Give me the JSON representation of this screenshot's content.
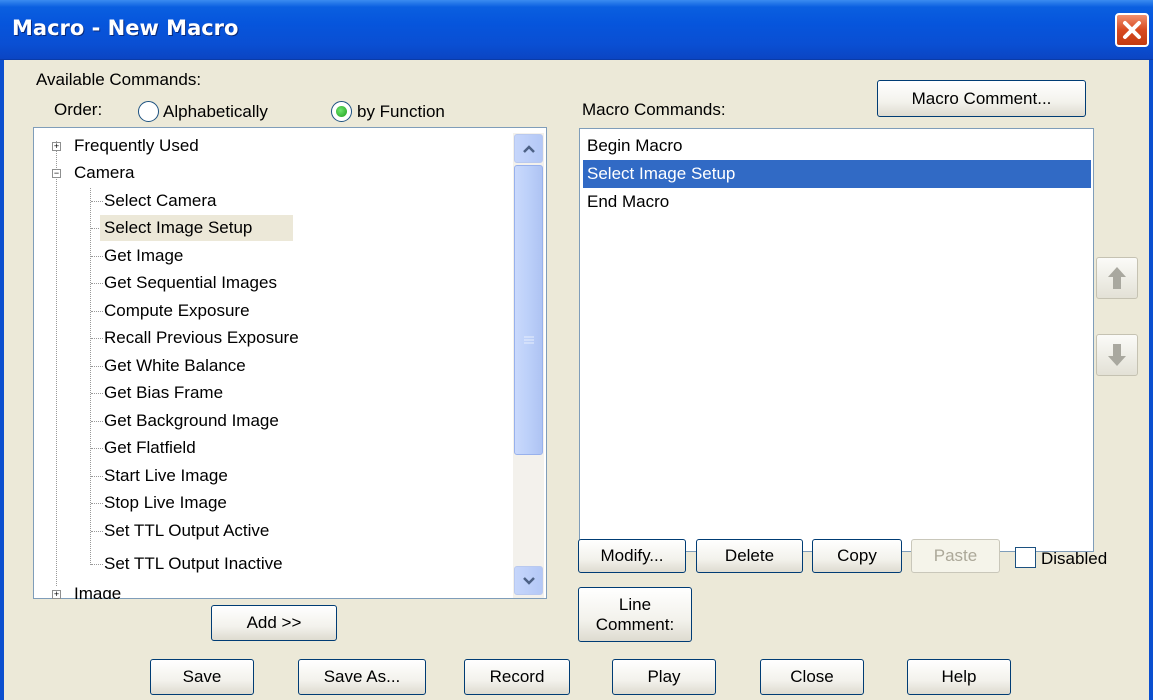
{
  "window": {
    "title": "Macro - New Macro"
  },
  "available": {
    "label": "Available Commands:",
    "order_label": "Order:",
    "order_options": [
      {
        "label": "Alphabetically",
        "checked": false
      },
      {
        "label": "by Function",
        "checked": true
      }
    ],
    "tree": {
      "groups": [
        {
          "label": "Frequently Used",
          "expanded": false
        },
        {
          "label": "Camera",
          "expanded": true
        },
        {
          "label": "Image",
          "expanded": false
        }
      ],
      "camera_items": [
        "Select Camera",
        "Select Image Setup",
        "Get Image",
        "Get Sequential Images",
        "Compute Exposure",
        "Recall Previous Exposure",
        "Get White Balance",
        "Get Bias Frame",
        "Get Background Image",
        "Get Flatfield",
        "Start Live Image",
        "Stop Live Image",
        "Set TTL Output Active",
        "Set TTL Output Inactive"
      ],
      "selected_item": "Select Image Setup"
    },
    "add_button": "Add >>"
  },
  "macro": {
    "label": "Macro Commands:",
    "comment_button": "Macro Comment...",
    "commands": [
      "Begin Macro",
      "Select Image Setup",
      "End Macro"
    ],
    "selected_command": "Select Image Setup",
    "buttons": {
      "modify": "Modify...",
      "delete": "Delete",
      "copy": "Copy",
      "paste": "Paste",
      "line_comment_1": "Line",
      "line_comment_2": "Comment:"
    },
    "disabled_label": "Disabled",
    "disabled_checked": false
  },
  "footer": {
    "save": "Save",
    "save_as": "Save As...",
    "record": "Record",
    "play": "Play",
    "close": "Close",
    "help": "Help"
  },
  "colors": {
    "titlebar": "#0a4fd3",
    "selection": "#316ac5",
    "dialog_bg": "#ece9d8"
  }
}
